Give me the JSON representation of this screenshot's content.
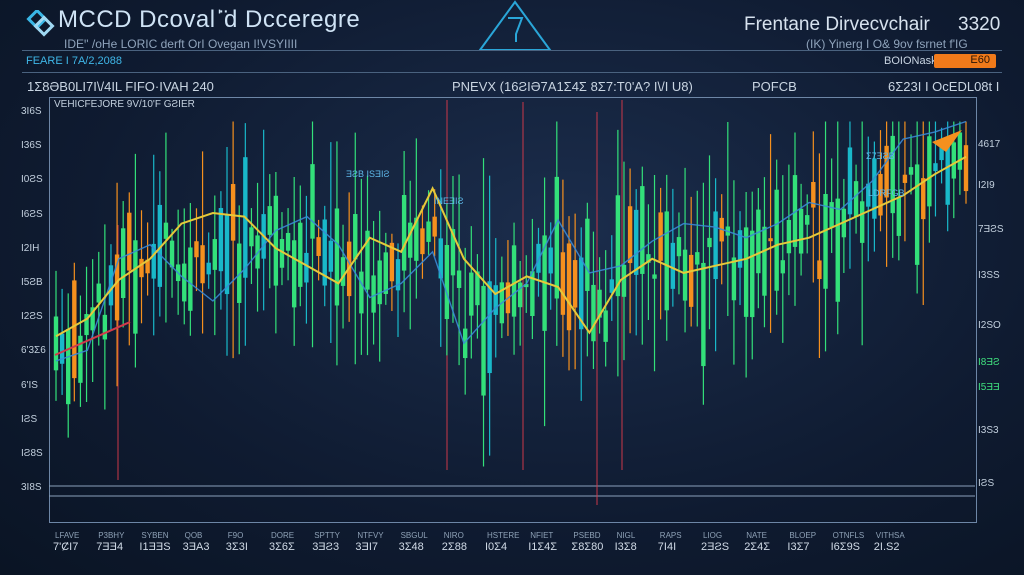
{
  "header": {
    "title": "MCCD",
    "title_rest": "Dcovalˈ̈d Dcceregre",
    "subtitle": "IDEꞌ' /oHe LORIC derft OrI Ovegan I!VSYIIII",
    "right_title": "Frentane   Dirvecvchair",
    "right_number": "3320",
    "right_subtitle": "(IK) Yinerg I O& 9ov fsrnet f'IG",
    "bar_left": "FEARE   I 7A/2,2088",
    "bar_right": "BOIONask",
    "bar_pill": "E60",
    "row_left": "1Ʃ8ƏB0LI7I\\/4IL FIFO·IVAH 240",
    "row_mid": "PNEVX (16ƧIƏ7A1Ʃ4Ʃ 8Ʃ7:T0'A? I\\/I U8)",
    "row_pocb": "POFCB",
    "row_right": "6Ʃ23I I OcEDL08t I"
  },
  "chart_data": {
    "type": "candlestick",
    "title": "VEHICFEJORE 9V/10'F GƧIER",
    "y_tick_labels": [
      "3I6S",
      "I36S",
      "I0ƧS",
      "I6ƧS",
      "I2IH",
      "I5ƧB",
      "I2ƧS",
      "6'3Ʃ6",
      "6'IS",
      "IƧS",
      "IƧ8S",
      "3I8S"
    ],
    "y_tick_labels_right": [
      "4617",
      "I2I9",
      "7ƎƧS",
      "I3SS",
      "I2SO",
      "I8ƎƧ",
      "I5ƎƎ",
      "I3S3",
      "IƧS"
    ],
    "x_tick_labels": [
      "7'ȻI7",
      "7ƎƎ4",
      "I1ƎƎS",
      "3ƎA3",
      "3Ʃ3I",
      "3Ʃ6Ʃ",
      "3ƎƧ3",
      "3ƎI7",
      "3Ʃ48",
      "2Ʃ88",
      "I0Ʃ4",
      "I1Ʃ4Ʃ",
      "Ʃ8Ʃ80",
      "I3Ʃ8",
      "7I4I",
      "2ƎƧS",
      "2Ʃ4Ʃ",
      "I3Ʃ7",
      "I6Ʃ9S",
      "2I.S2"
    ],
    "x_tick_small": [
      "LFAVE",
      "P3BHY",
      "SYBEN",
      "QOB",
      "F9O",
      "DORE",
      "SPTTY",
      "NTFVY",
      "SBGUL",
      "NIRO",
      "HSTERE",
      "NFIET",
      "PSEBD",
      "NIGL",
      "RAPS",
      "LIOG",
      "NATE",
      "BLOEP",
      "OTNFLS",
      "VITHSA"
    ],
    "annotations": [
      "ƎƧB ISƎIƧ",
      "INEƎIƧ",
      "Ʃ7ƎƧB",
      "LDRFGB"
    ],
    "series": [
      {
        "values": [
          38,
          43,
          54,
          60,
          70,
          73,
          72,
          63,
          58,
          53,
          66,
          62,
          80,
          60,
          50,
          55,
          52,
          39,
          54,
          60,
          56,
          58,
          60,
          64,
          66,
          70,
          74,
          78,
          84,
          89
        ]
      },
      {
        "values": [
          31,
          34,
          60,
          64,
          55,
          48,
          57,
          68,
          72,
          64,
          49,
          53,
          62,
          36,
          46,
          53,
          71,
          56,
          58,
          65,
          70,
          69,
          66,
          70,
          76,
          74,
          82,
          94,
          96,
          99
        ]
      }
    ],
    "ylim": [
      0,
      100
    ],
    "grid": false,
    "colors": {
      "up": "#33e07a",
      "teal": "#19b8c9",
      "orange": "#f5901e",
      "yellow": "#e5c93a",
      "blue": "#3a8ad6",
      "red": "#d23a4a"
    }
  }
}
